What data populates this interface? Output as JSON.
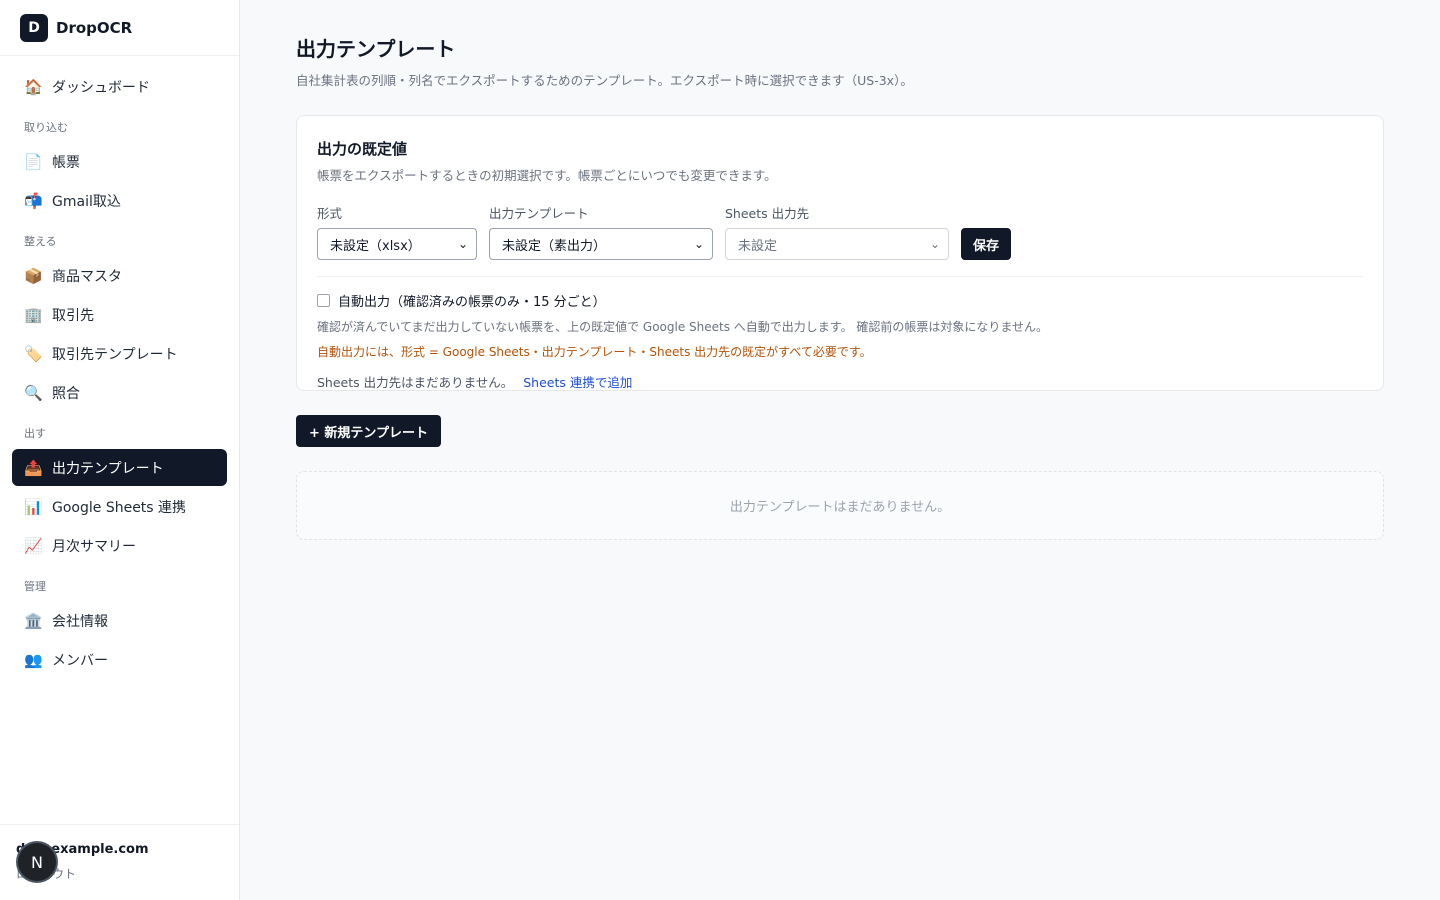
{
  "app": {
    "logo_letter": "D",
    "name": "DropOCR"
  },
  "sidebar": {
    "items": [
      {
        "icon": "🏠",
        "label": "ダッシュボード"
      },
      {
        "section": "取り込む"
      },
      {
        "icon": "📄",
        "label": "帳票"
      },
      {
        "icon": "📬",
        "label": "Gmail取込"
      },
      {
        "section": "整える"
      },
      {
        "icon": "📦",
        "label": "商品マスタ"
      },
      {
        "icon": "🏢",
        "label": "取引先"
      },
      {
        "icon": "🏷️",
        "label": "取引先テンプレート"
      },
      {
        "icon": "🔍",
        "label": "照合"
      },
      {
        "section": "出す"
      },
      {
        "icon": "📤",
        "label": "出力テンプレート",
        "active": true
      },
      {
        "icon": "📊",
        "label": "Google Sheets 連携"
      },
      {
        "icon": "📈",
        "label": "月次サマリー"
      },
      {
        "section": "管理"
      },
      {
        "icon": "🏛️",
        "label": "会社情報"
      },
      {
        "icon": "👥",
        "label": "メンバー"
      }
    ],
    "footer": {
      "email": "d…@example.com",
      "logout": "ログアウト",
      "badge": "N"
    }
  },
  "main": {
    "title": "出力テンプレート",
    "subtitle": "自社集計表の列順・列名でエクスポートするためのテンプレート。エクスポート時に選択できます（US-3x）。",
    "defaults_card": {
      "title": "出力の既定値",
      "description": "帳票をエクスポートするときの初期選択です。帳票ごとにいつでも変更できます。",
      "format": {
        "label": "形式",
        "value": "未設定（xlsx）"
      },
      "template": {
        "label": "出力テンプレート",
        "value": "未設定（素出力）"
      },
      "sheets": {
        "label": "Sheets 出力先",
        "value": "未設定"
      },
      "save_label": "保存",
      "auto_export": {
        "checked": false,
        "label": "自動出力（確認済みの帳票のみ・15 分ごと）",
        "note": "確認が済んでいてまだ出力していない帳票を、上の既定値で Google Sheets へ自動で出力します。 確認前の帳票は対象になりません。",
        "warning": "自動出力には、形式 = Google Sheets・出力テンプレート・Sheets 出力先の既定がすべて必要です。"
      },
      "sheets_status": "Sheets 出力先はまだありません。",
      "sheets_link": "Sheets 連携で追加"
    },
    "new_template_label": "+ 新規テンプレート",
    "empty_message": "出力テンプレートはまだありません。"
  }
}
